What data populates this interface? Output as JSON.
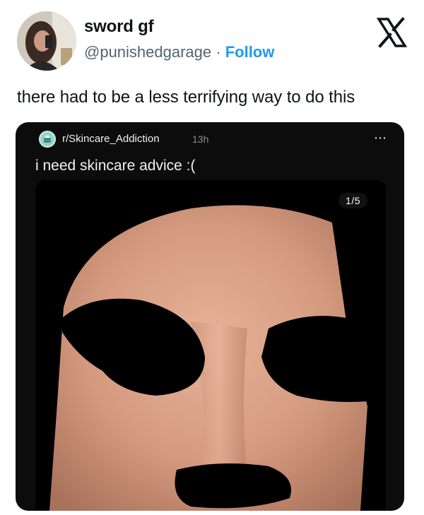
{
  "tweet": {
    "display_name": "sword gf",
    "handle": "@punishedgarage",
    "separator": " · ",
    "follow_label": "Follow",
    "text": "there had to be a less terrifying way to do this",
    "platform_icon": "x-logo-icon"
  },
  "embedded_post": {
    "subreddit": "r/Skincare_Addiction",
    "time_ago": "13h",
    "more_icon": "⋯",
    "title": "i need skincare advice :(",
    "image_counter": "1/5"
  },
  "colors": {
    "accent": "#1d9bf0",
    "text_primary": "#0f1419",
    "text_secondary": "#536471",
    "embed_background": "#0c0c0c"
  }
}
